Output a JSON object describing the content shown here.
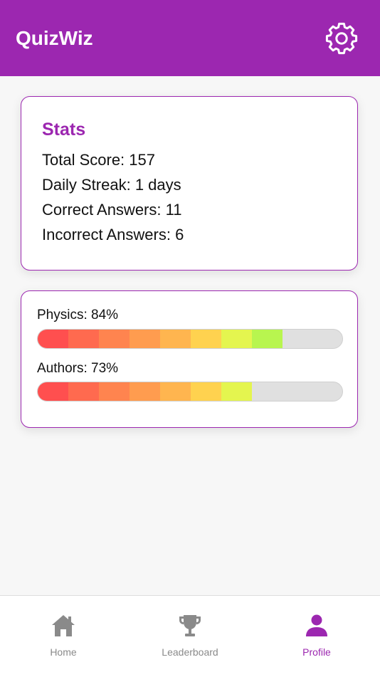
{
  "header": {
    "title": "QuizWiz",
    "settings_icon": "gear-icon"
  },
  "stats": {
    "title": "Stats",
    "lines": [
      "Total Score: 157",
      "Daily Streak: 1 days",
      "Correct Answers: 11",
      "Incorrect Answers: 6"
    ]
  },
  "progress": [
    {
      "label": "Physics: 84%",
      "percent": 84
    },
    {
      "label": "Authors: 73%",
      "percent": 73
    }
  ],
  "progress_colors": [
    "#ff4f4f",
    "#ff6a4f",
    "#ff844f",
    "#ff9c4f",
    "#ffb54f",
    "#ffd24f",
    "#e4f54f",
    "#b8f54f",
    "#8cf54f"
  ],
  "tabbar": {
    "tabs": [
      {
        "label": "Home",
        "icon": "home-icon",
        "active": false
      },
      {
        "label": "Leaderboard",
        "icon": "trophy-icon",
        "active": false
      },
      {
        "label": "Profile",
        "icon": "person-icon",
        "active": true
      }
    ]
  },
  "colors": {
    "accent": "#9c27b0",
    "inactive_tab": "#8a8a8a"
  }
}
